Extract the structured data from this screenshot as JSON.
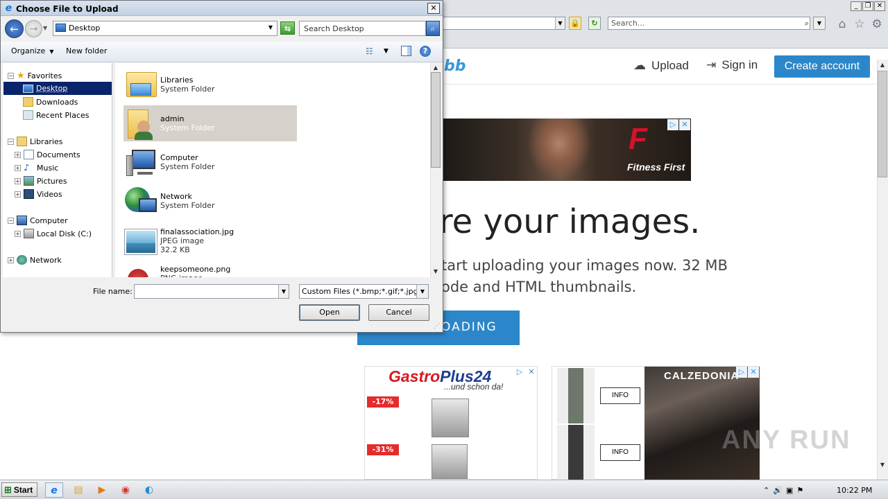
{
  "browser": {
    "search_placeholder": "Search...",
    "win_minimize": "_",
    "win_restore": "❐",
    "win_close": "✕"
  },
  "site": {
    "logo_fragment": "bb",
    "upload_label": "Upload",
    "signin_label": "Sign in",
    "create_account_label": "Create account",
    "ad_brand": "Fitness First",
    "hero_title": "re your images.",
    "hero_line1": "tart uploading your images now. 32 MB",
    "hero_line2": "ode and HTML thumbnails.",
    "start_button": "OADING",
    "ad2_brand_red": "Gastro",
    "ad2_brand_blue": "Plus24",
    "ad2_sub": "...und schon da!",
    "ad2_discount1": "-17%",
    "ad2_discount2": "-31%",
    "ad3_brand": "CALZEDONIA",
    "ad3_info1": "INFO",
    "ad3_info2": "INFO",
    "watermark": "ANY RUN"
  },
  "dialog": {
    "title": "Choose File to Upload",
    "location": "Desktop",
    "search_placeholder": "Search Desktop",
    "toolbar": {
      "organize": "Organize",
      "new_folder": "New folder"
    },
    "nav_tree": {
      "favorites": "Favorites",
      "desktop": "Desktop",
      "downloads": "Downloads",
      "recent": "Recent Places",
      "libraries": "Libraries",
      "documents": "Documents",
      "music": "Music",
      "pictures": "Pictures",
      "videos": "Videos",
      "computer": "Computer",
      "local_disk": "Local Disk (C:)",
      "network": "Network"
    },
    "files": [
      {
        "name": "Libraries",
        "type": "System Folder",
        "icon": "libraries-icon"
      },
      {
        "name": "admin",
        "type": "System Folder",
        "icon": "user-folder-icon"
      },
      {
        "name": "Computer",
        "type": "System Folder",
        "icon": "computer-icon"
      },
      {
        "name": "Network",
        "type": "System Folder",
        "icon": "network-icon"
      },
      {
        "name": "finalassociation.jpg",
        "type": "JPEG image",
        "size": "32.2 KB",
        "icon": "image-file-icon"
      },
      {
        "name": "keepsomeone.png",
        "type": "PNG image",
        "icon": "image-file-icon"
      }
    ],
    "file_name_label": "File name:",
    "file_name_value": "",
    "file_type": "Custom Files (*.bmp;*.gif;*.jpg;",
    "open_label": "Open",
    "cancel_label": "Cancel"
  },
  "taskbar": {
    "start_label": "Start",
    "clock": "10:22 PM"
  }
}
